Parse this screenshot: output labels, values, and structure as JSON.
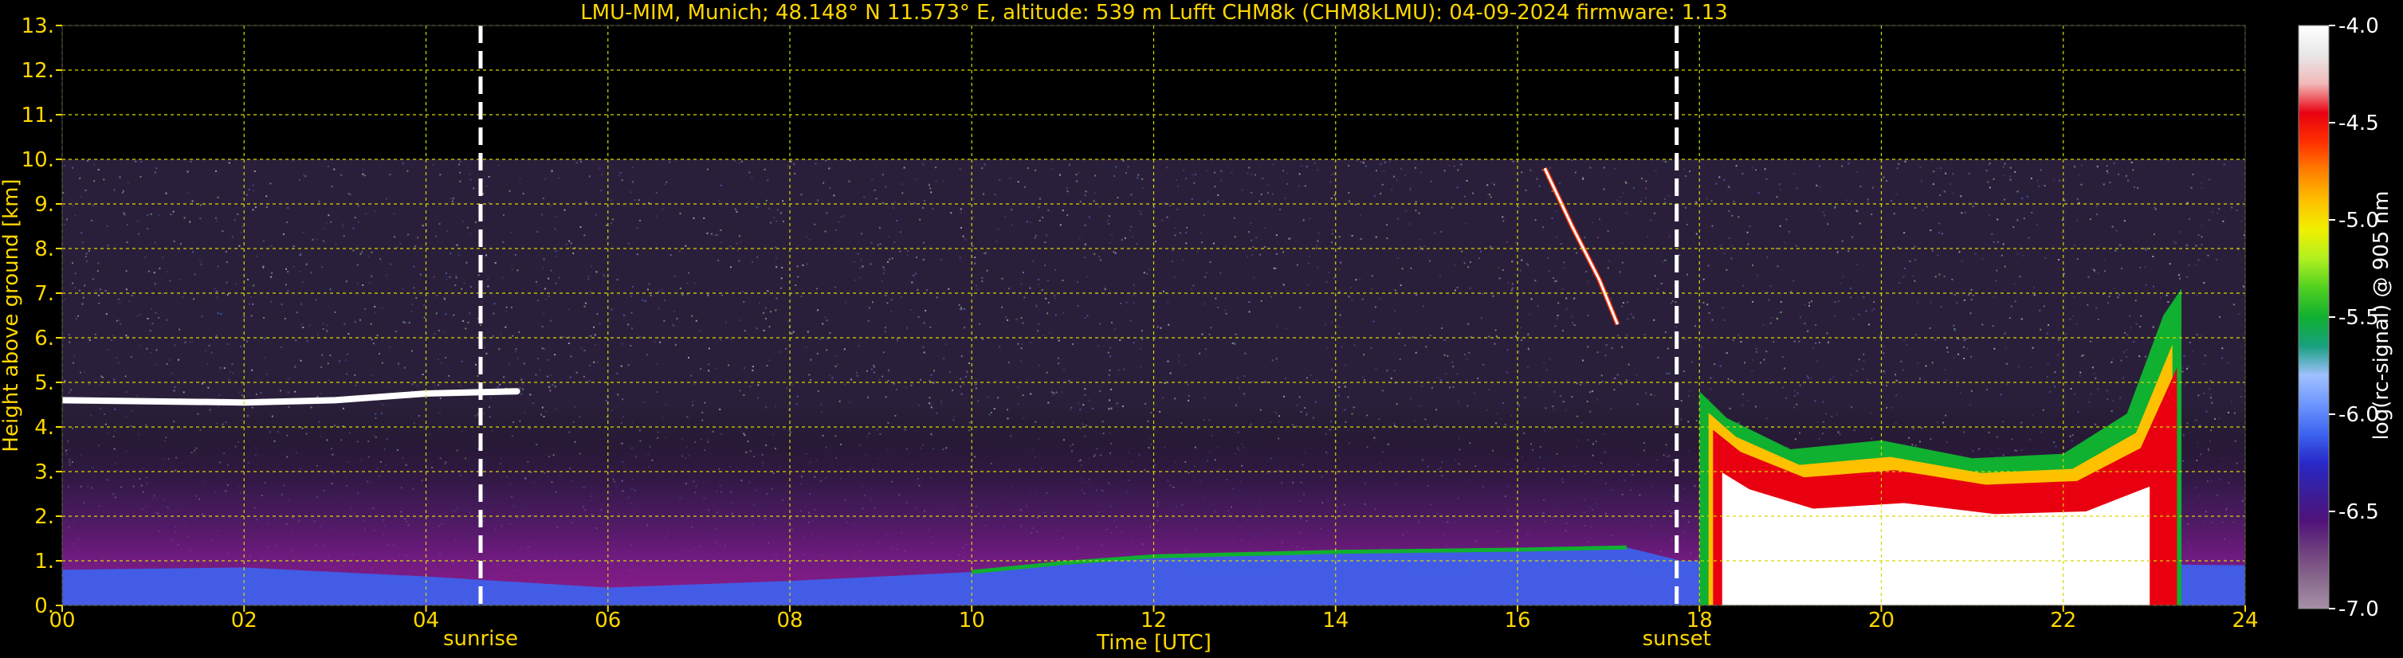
{
  "chart_data": {
    "type": "heatmap",
    "title": "LMU-MIM, Munich; 48.148° N 11.573° E, altitude: 539 m    Lufft CHM8k (CHM8kLMU): 04-09-2024    firmware: 1.13",
    "xlabel": "Time [UTC]",
    "ylabel": "Height above ground [km]",
    "xlim": [
      0,
      24
    ],
    "ylim": [
      0,
      13
    ],
    "x_ticks": [
      "00",
      "02",
      "04",
      "06",
      "08",
      "10",
      "12",
      "14",
      "16",
      "18",
      "20",
      "22",
      "24"
    ],
    "y_ticks": [
      "0.",
      "1.",
      "2.",
      "3.",
      "4.",
      "5.",
      "6.",
      "7.",
      "8.",
      "9.",
      "10.",
      "11.",
      "12.",
      "13."
    ],
    "grid": true,
    "data_top_km": 10,
    "events": [
      {
        "label": "sunrise",
        "time": 4.6
      },
      {
        "label": "sunset",
        "time": 17.75
      }
    ],
    "features": {
      "aerosol_layer": [
        [
          0,
          0.8
        ],
        [
          2,
          0.85
        ],
        [
          4,
          0.65
        ],
        [
          6,
          0.4
        ],
        [
          8,
          0.55
        ],
        [
          10,
          0.75
        ],
        [
          11,
          0.95
        ],
        [
          12,
          1.1
        ],
        [
          14,
          1.2
        ],
        [
          16,
          1.25
        ],
        [
          17.2,
          1.3
        ],
        [
          17.8,
          1.0
        ],
        [
          24,
          0.9
        ]
      ],
      "cloud_layer_morning": [
        [
          0,
          4.6
        ],
        [
          2,
          4.55
        ],
        [
          3,
          4.6
        ],
        [
          4,
          4.75
        ],
        [
          5,
          4.8
        ]
      ],
      "cirrus_streak": [
        [
          16.3,
          9.8
        ],
        [
          16.6,
          8.5
        ],
        [
          16.9,
          7.3
        ],
        [
          17.1,
          6.3
        ]
      ],
      "evening_cloud_top": [
        [
          18.0,
          4.8
        ],
        [
          18.3,
          4.2
        ],
        [
          19,
          3.5
        ],
        [
          20,
          3.7
        ],
        [
          21,
          3.3
        ],
        [
          22,
          3.4
        ],
        [
          22.7,
          4.3
        ],
        [
          23.1,
          6.5
        ],
        [
          23.3,
          7.1
        ]
      ]
    },
    "colorbar": {
      "label": "log(rc-signal) @ 905 nm",
      "ticks": [
        "-4.0",
        "-4.5",
        "-5.0",
        "-5.5",
        "-6.0",
        "-6.5",
        "-7.0"
      ],
      "range": [
        -7.0,
        -4.0
      ],
      "colors": [
        "#a690a8",
        "#8a6a8e",
        "#6e3f7e",
        "#50127a",
        "#3a1e9a",
        "#2828c8",
        "#3c64f0",
        "#6e96ff",
        "#a0c0ff",
        "#18a080",
        "#10b030",
        "#50d020",
        "#b0f020",
        "#f0f000",
        "#ffc000",
        "#ff8000",
        "#ff3000",
        "#e80010",
        "#f2b8b8",
        "#e8e8e8",
        "#ffffff"
      ]
    }
  }
}
